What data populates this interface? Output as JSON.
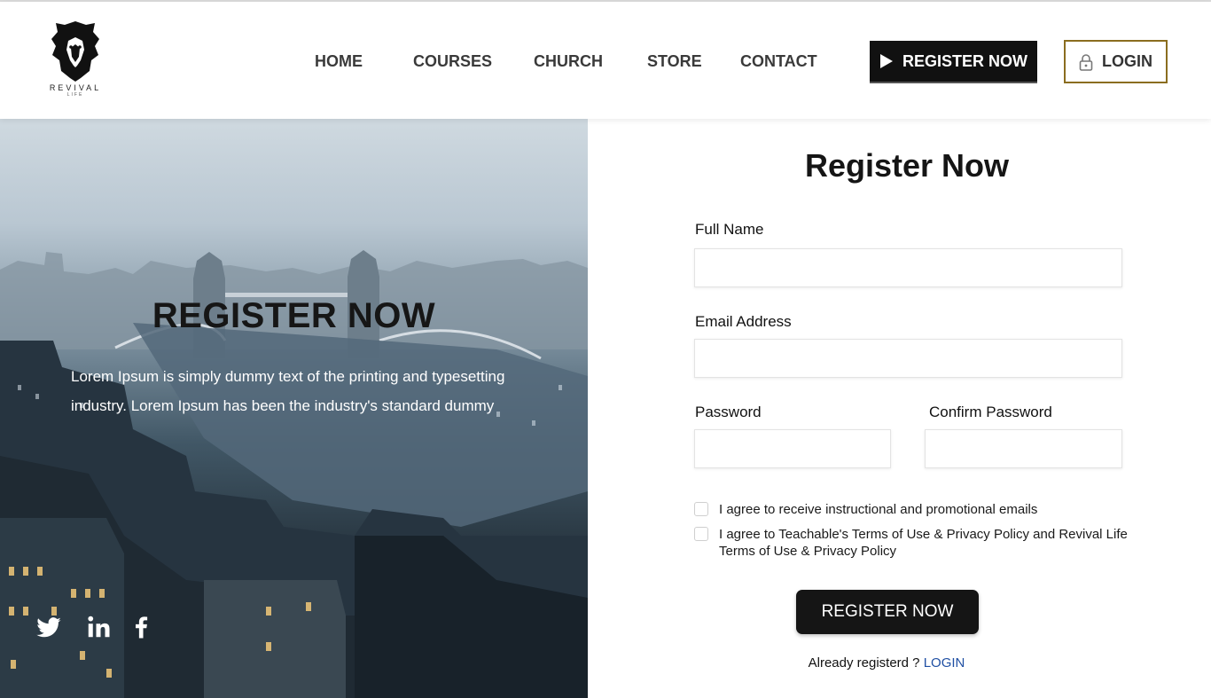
{
  "logo": {
    "brand": "REVIVAL",
    "sub": "LIFE",
    "icon": "lion-icon"
  },
  "nav": {
    "items": [
      "HOME",
      "COURSES",
      "CHURCH",
      "STORE",
      "CONTACT"
    ]
  },
  "header_buttons": {
    "register": "REGISTER NOW",
    "login": "LOGIN"
  },
  "hero": {
    "title": "REGISTER NOW",
    "text": "Lorem Ipsum is simply dummy text of the printing and typesetting industry. Lorem Ipsum has been the industry's standard dummy",
    "social": [
      "twitter-icon",
      "linkedin-icon",
      "facebook-icon"
    ]
  },
  "form": {
    "title": "Register Now",
    "full_name_label": "Full Name",
    "full_name_value": "",
    "email_label": "Email Address",
    "email_value": "",
    "password_label": "Password",
    "password_value": "",
    "confirm_label": "Confirm Password",
    "confirm_value": "",
    "check_emails": "I agree to receive instructional and promotional emails",
    "check_terms": "I agree to Teachable's Terms of Use & Privacy Policy and Revival Life Terms of Use & Privacy Policy",
    "submit": "REGISTER NOW",
    "already_text": "Already registerd ?",
    "already_link": "LOGIN"
  },
  "colors": {
    "dark": "#111111",
    "gold_border": "#8a6d1f",
    "link_blue": "#1f4fa3"
  }
}
